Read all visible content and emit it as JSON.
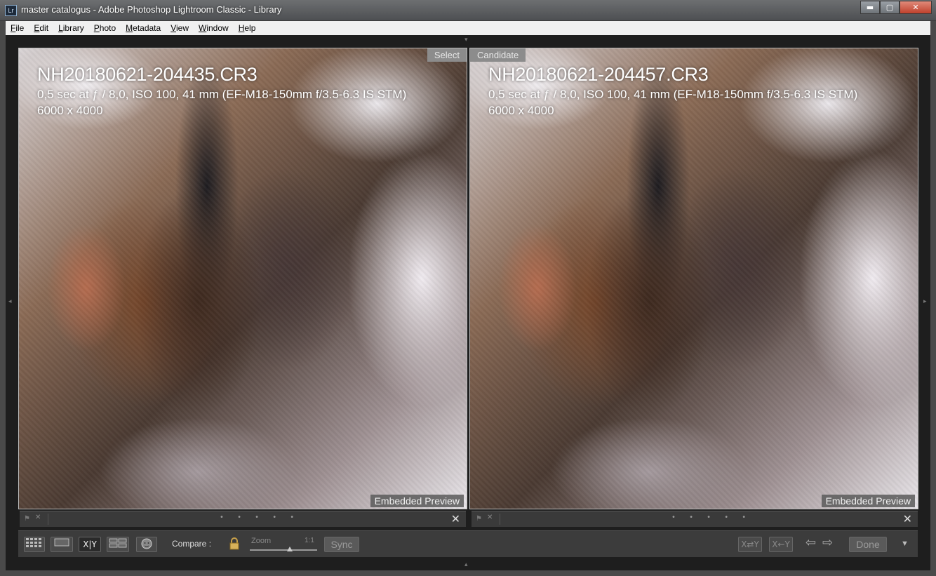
{
  "window": {
    "app_icon": "Lr",
    "title": "master catalogus - Adobe Photoshop Lightroom Classic - Library",
    "minimize_glyph": "▬",
    "maximize_glyph": "▢",
    "close_glyph": "✕"
  },
  "menu": [
    "File",
    "Edit",
    "Library",
    "Photo",
    "Metadata",
    "View",
    "Window",
    "Help"
  ],
  "panes": {
    "select": {
      "label": "Select",
      "filename": "NH20180621-204435.CR3",
      "exif": "0,5 sec at ƒ / 8,0, ISO 100, 41 mm (EF-M18-150mm f/3.5-6.3 IS STM)",
      "dimensions": "6000 x 4000",
      "preview_label": "Embedded Preview"
    },
    "candidate": {
      "label": "Candidate",
      "filename": "NH20180621-204457.CR3",
      "exif": "0,5 sec at ƒ / 8,0, ISO 100, 41 mm (EF-M18-150mm f/3.5-6.3 IS STM)",
      "dimensions": "6000 x 4000",
      "preview_label": "Embedded Preview"
    }
  },
  "strip": {
    "flag_icon": "flag-icon",
    "reject_glyph": "✕",
    "rating_dots": "• • • • •",
    "close_glyph": "✕"
  },
  "toolbar": {
    "grid_icon": "grid-view-icon",
    "loupe_icon": "loupe-view-icon",
    "compare_label": "X|Y",
    "survey_icon": "survey-view-icon",
    "people_icon": "people-view-icon",
    "compare_text": "Compare :",
    "lock_icon": "lock-icon",
    "zoom_label": "Zoom",
    "zoom_value": "1:1",
    "sync_label": "Sync",
    "swap_label": "X⇄Y",
    "make_select_label": "X←Y",
    "prev_glyph": "⇦",
    "next_glyph": "⇨",
    "done_label": "Done",
    "menu_glyph": "▼"
  }
}
